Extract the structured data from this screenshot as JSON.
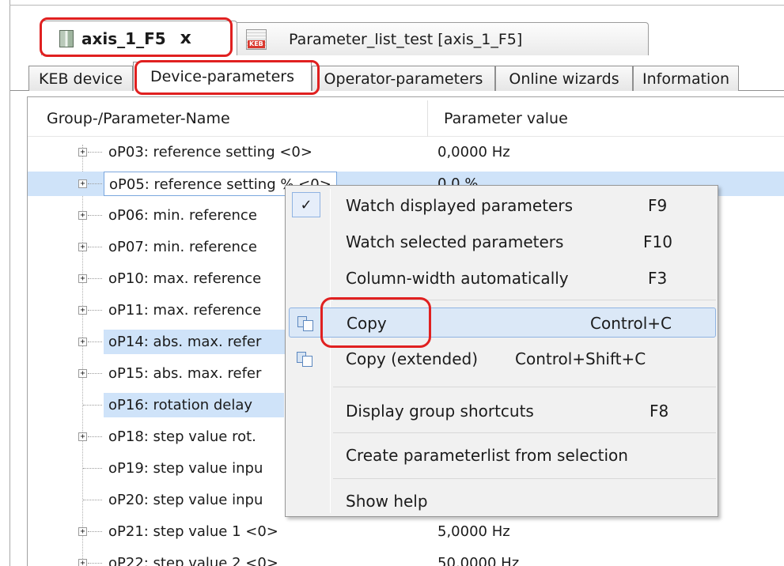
{
  "doc_tabs": [
    {
      "label": "axis_1_F5",
      "close": "x"
    },
    {
      "label": "Parameter_list_test [axis_1_F5]",
      "icon_badge": "KEB"
    }
  ],
  "sub_tabs": [
    "KEB device",
    "Device-parameters",
    "Operator-parameters",
    "Online wizards",
    "Information"
  ],
  "columns": {
    "name": "Group-/Parameter-Name",
    "value": "Parameter value"
  },
  "rows": [
    {
      "name": "oP03: reference setting <0>",
      "value": "0,0000 Hz"
    },
    {
      "name": "oP05: reference setting % <0>",
      "value": "0,0 %"
    },
    {
      "name": "oP06: min. reference",
      "value": ""
    },
    {
      "name": "oP07: min. reference",
      "value": ""
    },
    {
      "name": "oP10: max. reference",
      "value": ""
    },
    {
      "name": "oP11: max. reference",
      "value": ""
    },
    {
      "name": "oP14: abs. max. refer",
      "value": ""
    },
    {
      "name": "oP15: abs. max. refer",
      "value": ""
    },
    {
      "name": "oP16: rotation delay",
      "value": ""
    },
    {
      "name": "oP18: step value rot.",
      "value": ""
    },
    {
      "name": "oP19: step value inpu",
      "value": ""
    },
    {
      "name": "oP20: step value inpu",
      "value": ""
    },
    {
      "name": "oP21: step value 1 <0>",
      "value": "5,0000 Hz"
    },
    {
      "name": "oP22: step value 2 <0>",
      "value": "50,0000 Hz"
    }
  ],
  "context_menu": {
    "items": [
      {
        "label": "Watch displayed parameters",
        "shortcut": "F9",
        "checked": true
      },
      {
        "label": "Watch selected parameters",
        "shortcut": "F10"
      },
      {
        "label": "Column-width automatically",
        "shortcut": "F3"
      },
      {
        "label": "Copy",
        "shortcut": "Control+C"
      },
      {
        "label": "Copy (extended)",
        "shortcut": "Control+Shift+C"
      },
      {
        "label": "Display group shortcuts",
        "shortcut": "F8"
      },
      {
        "label": "Create parameterlist from selection",
        "shortcut": ""
      },
      {
        "label": "Show help",
        "shortcut": ""
      }
    ]
  },
  "colors": {
    "highlight": "#e02020",
    "selection": "#cfe3f9",
    "menu_bg": "#f1f1f1"
  }
}
